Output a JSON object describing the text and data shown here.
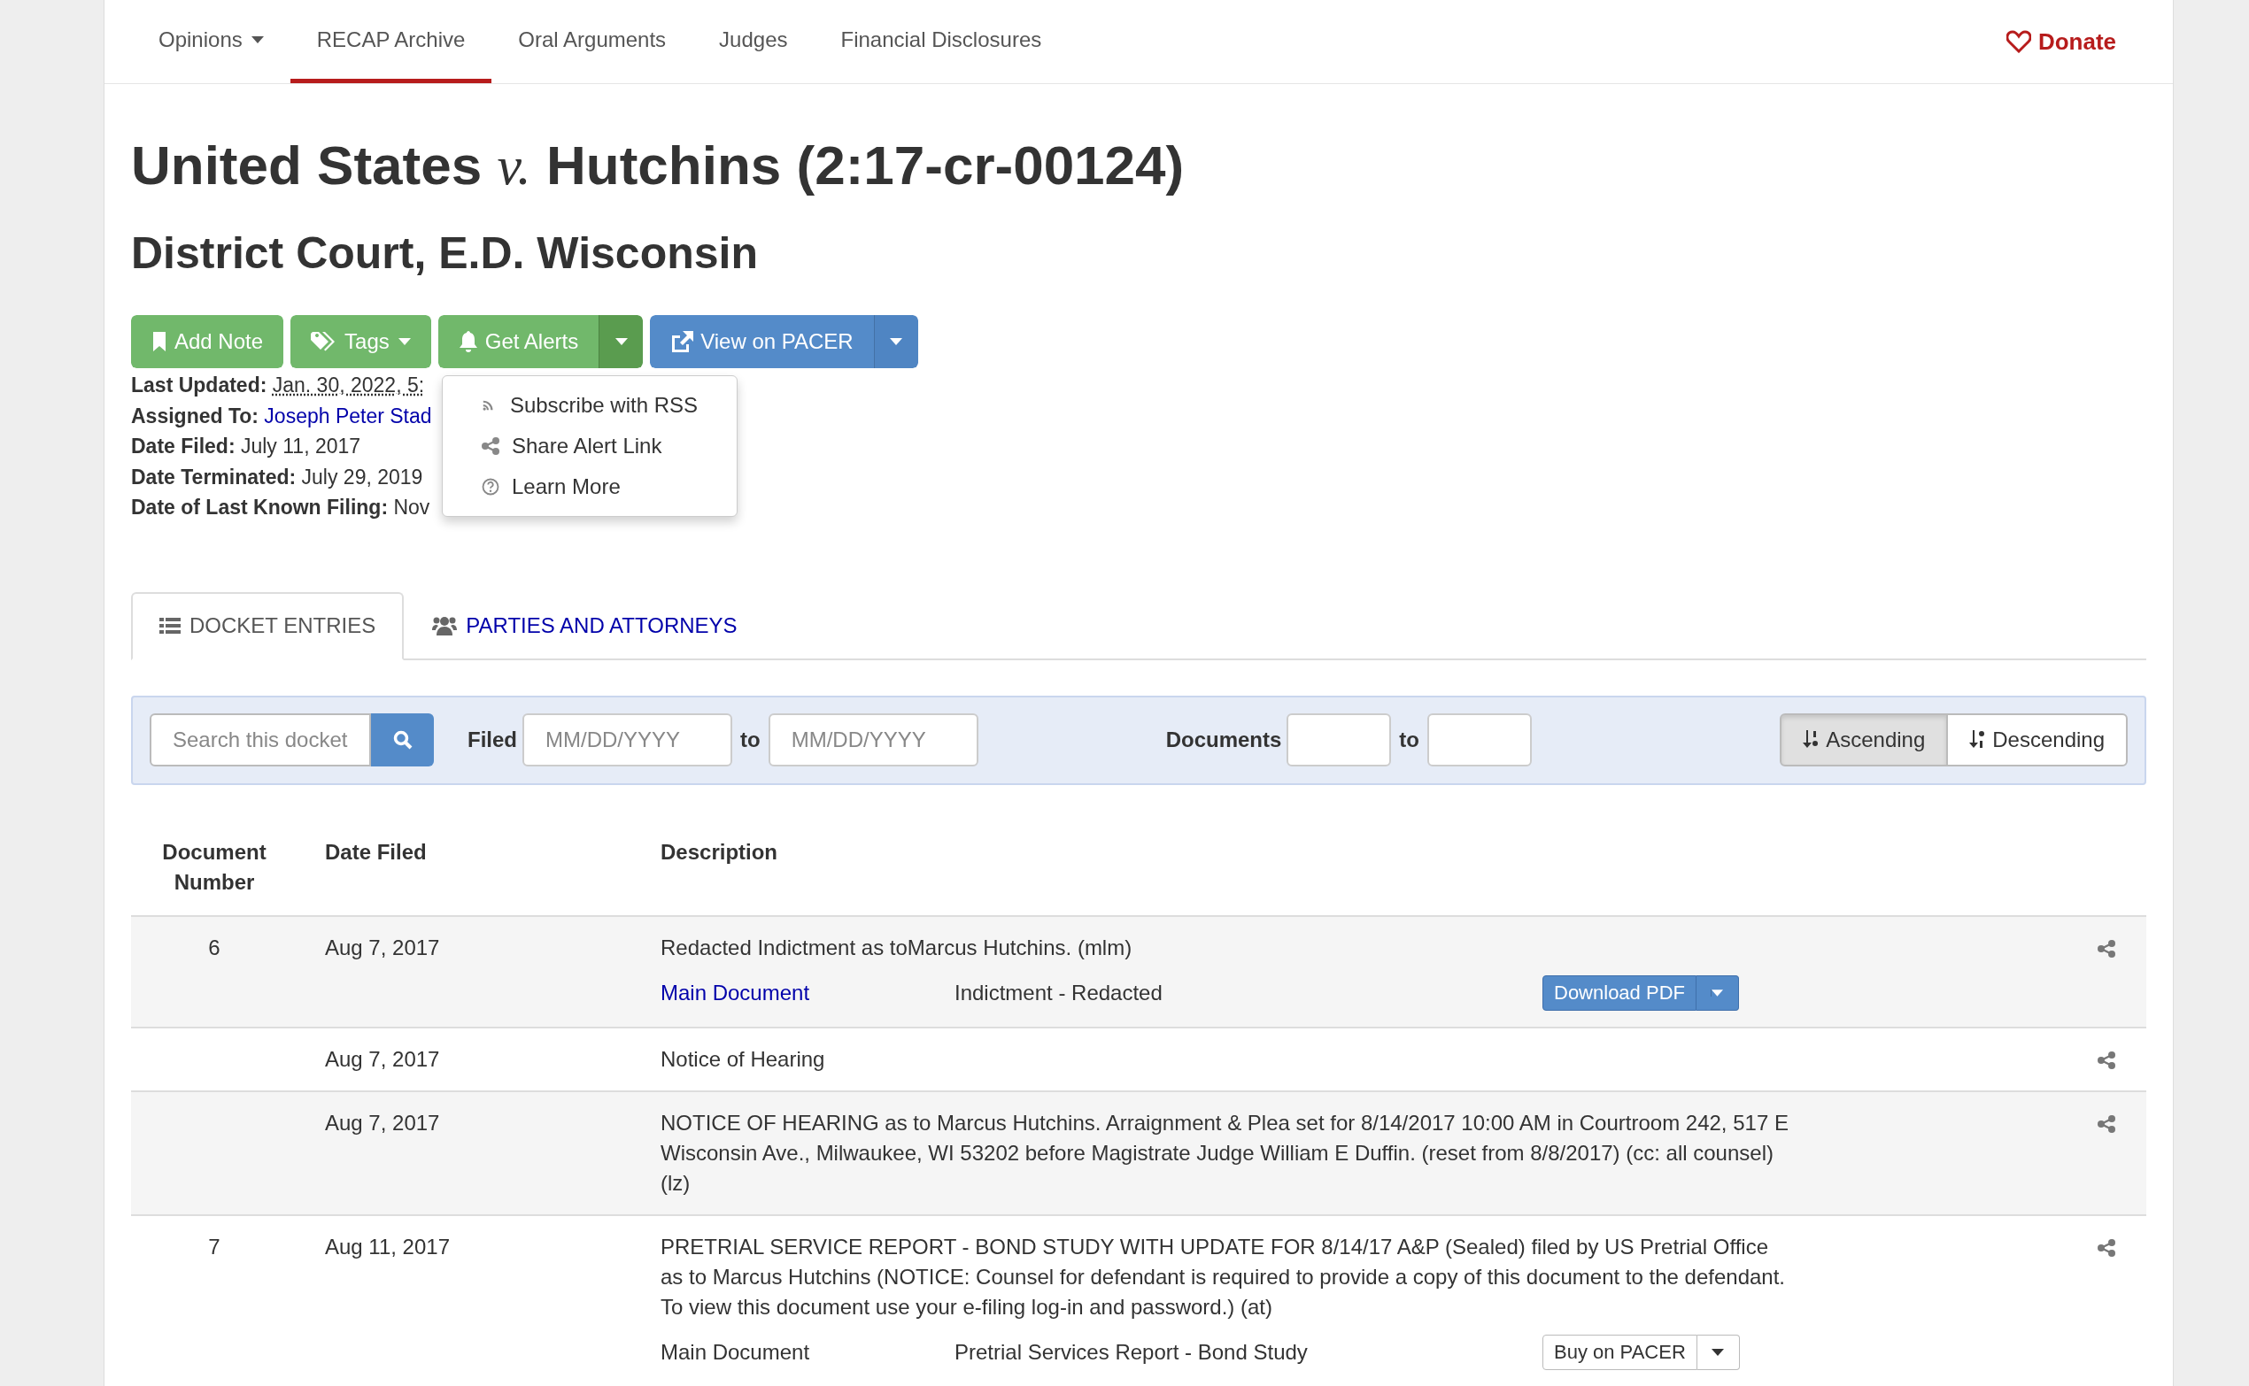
{
  "nav": {
    "items": [
      {
        "label": "Opinions",
        "selected": false,
        "caret": true
      },
      {
        "label": "RECAP Archive",
        "selected": true,
        "caret": false
      },
      {
        "label": "Oral Arguments",
        "selected": false,
        "caret": false
      },
      {
        "label": "Judges",
        "selected": false,
        "caret": false
      },
      {
        "label": "Financial Disclosures",
        "selected": false,
        "caret": false
      }
    ],
    "donate": "Donate"
  },
  "title": "United States *v.* Hutchins (2:17-cr-00124)",
  "court": "District Court, E.D. Wisconsin",
  "actions": [
    {
      "label": "Add Note",
      "kind": "success",
      "caret": false,
      "split": false
    },
    {
      "label": "Tags",
      "kind": "success",
      "caret": true,
      "split": false
    },
    {
      "label": "Get Alerts",
      "kind": "success",
      "caret": false,
      "split": true,
      "expanded": true
    },
    {
      "label": "View on PACER",
      "kind": "primary",
      "caret": false,
      "split": true,
      "expanded": false
    }
  ],
  "alerts_menu": [
    {
      "label": "Subscribe with RSS"
    },
    {
      "label": "Share Alert Link"
    },
    {
      "label": "Learn More"
    }
  ],
  "metadata": [
    {
      "label": "Last Updated:",
      "value": "Jan. 30, 2022, 5:",
      "link": false
    },
    {
      "label": "Assigned To:",
      "value": "Joseph Peter Stad",
      "link": true
    },
    {
      "label": "Date Filed:",
      "value": "July 11, 2017",
      "link": false
    },
    {
      "label": "Date Terminated:",
      "value": "July 29, 2019",
      "link": false
    },
    {
      "label": "Date of Last Known Filing:",
      "value": "Nov",
      "link": false
    }
  ],
  "tabs": [
    {
      "label": "DOCKET ENTRIES",
      "selected": true
    },
    {
      "label": "PARTIES AND ATTORNEYS",
      "selected": false
    }
  ],
  "filters": {
    "search_placeholder": "Search this docket",
    "filed_label": "Filed",
    "date_from_placeholder": "MM/DD/YYYY",
    "date_to_label": "to",
    "date_to_placeholder": "MM/DD/YYYY",
    "documents_label": "Documents",
    "documents_to_label": "to",
    "sort": [
      {
        "label": "Ascending",
        "selected": true
      },
      {
        "label": "Descending",
        "selected": false
      }
    ]
  },
  "table": {
    "columns": [
      "Document Number",
      "Date Filed",
      "Description"
    ],
    "rows": [
      {
        "number": "6",
        "date": "Aug 7, 2017",
        "description": "Redacted Indictment as toMarcus Hutchins. (mlm)",
        "attachments": [
          {
            "name": "Main Document",
            "link": true,
            "description": "Indictment - Redacted",
            "button": {
              "label": "Download PDF",
              "kind": "primary"
            }
          }
        ]
      },
      {
        "date": "Aug 7, 2017",
        "description": "Notice of Hearing"
      },
      {
        "date": "Aug 7, 2017",
        "description": "NOTICE OF HEARING as to Marcus Hutchins. Arraignment & Plea set for 8/14/2017 10:00 AM in Courtroom 242, 517 E Wisconsin Ave., Milwaukee, WI 53202 before Magistrate Judge William E Duffin. (reset from 8/8/2017) (cc: all counsel)(lz)"
      },
      {
        "number": "7",
        "date": "Aug 11, 2017",
        "description": "PRETRIAL SERVICE REPORT - BOND STUDY WITH UPDATE FOR 8/14/17 A&P (Sealed) filed by US Pretrial Office as to Marcus Hutchins (NOTICE: Counsel for defendant is required to provide a copy of this document to the defendant. To view this document use your e-filing log-in and password.) (at)",
        "attachments": [
          {
            "name": "Main Document",
            "link": false,
            "description": "Pretrial Services Report - Bond Study",
            "button": {
              "label": "Buy on PACER",
              "kind": "default"
            }
          }
        ]
      }
    ]
  }
}
